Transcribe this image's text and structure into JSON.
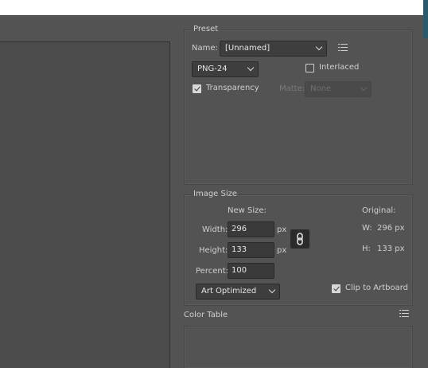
{
  "preset": {
    "section_title": "Preset",
    "name_label": "Name:",
    "name_value": "[Unnamed]",
    "format_value": "PNG-24",
    "interlaced_label": "Interlaced",
    "interlaced_checked": false,
    "transparency_label": "Transparency",
    "transparency_checked": true,
    "matte_label": "Matte:",
    "matte_value": "None"
  },
  "image_size": {
    "section_title": "Image Size",
    "new_size_label": "New Size:",
    "original_label": "Original:",
    "width_label": "Width:",
    "width_value": "296",
    "height_label": "Height:",
    "height_value": "133",
    "percent_label": "Percent:",
    "percent_value": "100",
    "unit": "px",
    "orig_w_label": "W:",
    "orig_w_value": "296 px",
    "orig_h_label": "H:",
    "orig_h_value": "133 px",
    "quality_value": "Art Optimized",
    "clip_label": "Clip to Artboard",
    "clip_checked": true
  },
  "color_table": {
    "section_title": "Color Table"
  }
}
